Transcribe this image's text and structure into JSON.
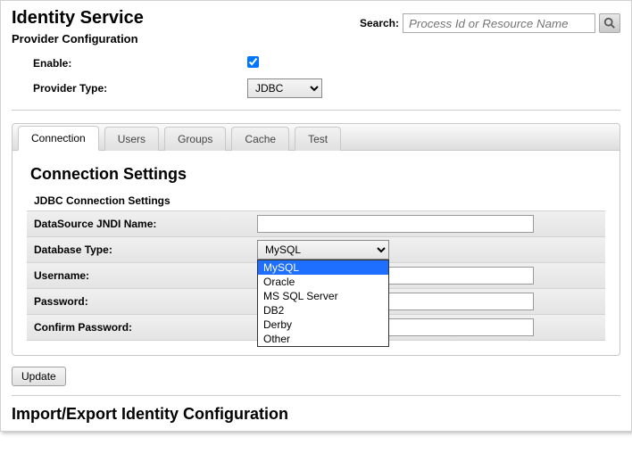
{
  "header": {
    "title": "Identity Service",
    "section": "Provider Configuration",
    "search_label": "Search:",
    "search_placeholder": "Process Id or Resource Name"
  },
  "provider": {
    "enable_label": "Enable:",
    "enable_checked": true,
    "type_label": "Provider Type:",
    "type_value": "JDBC"
  },
  "tabs": [
    {
      "label": "Connection",
      "active": true
    },
    {
      "label": "Users",
      "active": false
    },
    {
      "label": "Groups",
      "active": false
    },
    {
      "label": "Cache",
      "active": false
    },
    {
      "label": "Test",
      "active": false
    }
  ],
  "connection": {
    "title": "Connection Settings",
    "subhead": "JDBC Connection Settings",
    "fields": {
      "jndi_label": "DataSource JNDI Name:",
      "jndi_value": "",
      "dbtype_label": "Database Type:",
      "dbtype_selected": "MySQL",
      "dbtype_options": [
        "MySQL",
        "Oracle",
        "MS SQL Server",
        "DB2",
        "Derby",
        "Other"
      ],
      "username_label": "Username:",
      "username_value": "",
      "password_label": "Password:",
      "password_value": "",
      "confirm_label": "Confirm Password:",
      "confirm_value": ""
    }
  },
  "buttons": {
    "update": "Update"
  },
  "import_export": {
    "title": "Import/Export Identity Configuration"
  }
}
